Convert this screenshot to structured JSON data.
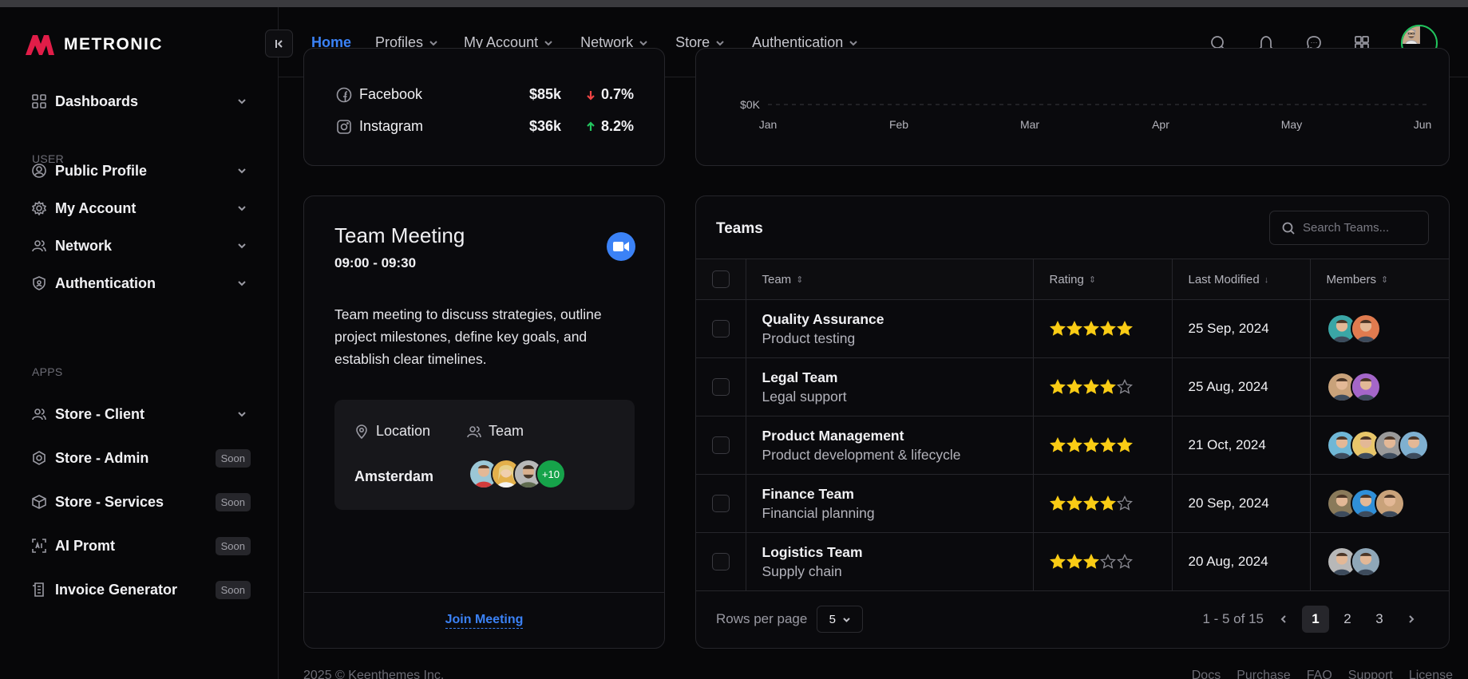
{
  "app": {
    "brand": "METRONIC"
  },
  "sidebar": {
    "dashboards": "Dashboards",
    "section_user": "USER",
    "public_profile": "Public Profile",
    "my_account": "My Account",
    "network": "Network",
    "authentication": "Authentication",
    "section_apps": "APPS",
    "store_client": "Store - Client",
    "store_admin": "Store - Admin",
    "store_services": "Store - Services",
    "ai_promt": "AI Promt",
    "invoice_generator": "Invoice Generator",
    "soon_badge": "Soon"
  },
  "header": {
    "menu": [
      "Home",
      "Profiles",
      "My Account",
      "Network",
      "Store",
      "Authentication"
    ]
  },
  "social": [
    {
      "name": "Facebook",
      "amount": "$85k",
      "change": "0.7%",
      "direction": "down"
    },
    {
      "name": "Instagram",
      "amount": "$36k",
      "change": "8.2%",
      "direction": "up"
    }
  ],
  "chart_data": {
    "type": "line",
    "categories": [
      "Jan",
      "Feb",
      "Mar",
      "Apr",
      "May",
      "Jun"
    ],
    "y_tick_visible": "$0K",
    "grid": true
  },
  "meeting": {
    "title": "Team Meeting",
    "time": "09:00 - 09:30",
    "description": "Team meeting to discuss strategies, outline project milestones, define key goals, and establish clear timelines.",
    "location_label": "Location",
    "team_label": "Team",
    "location_value": "Amsterdam",
    "more_members": "+10",
    "join_label": "Join Meeting"
  },
  "teams": {
    "title": "Teams",
    "search_placeholder": "Search Teams...",
    "columns": [
      "Team",
      "Rating",
      "Last Modified",
      "Members"
    ],
    "rows": [
      {
        "name": "Quality Assurance",
        "desc": "Product testing",
        "rating": 5,
        "modified": "25 Sep, 2024",
        "members": 2
      },
      {
        "name": "Legal Team",
        "desc": "Legal support",
        "rating": 4,
        "modified": "25 Aug, 2024",
        "members": 2
      },
      {
        "name": "Product Management",
        "desc": "Product development & lifecycle",
        "rating": 5,
        "modified": "21 Oct, 2024",
        "members": 4
      },
      {
        "name": "Finance Team",
        "desc": "Financial planning",
        "rating": 4,
        "modified": "20 Sep, 2024",
        "members": 3
      },
      {
        "name": "Logistics Team",
        "desc": "Supply chain",
        "rating": 3,
        "modified": "20 Aug, 2024",
        "members": 2
      }
    ],
    "rows_per_page_label": "Rows per page",
    "rows_per_page_value": "5",
    "page_info": "1 - 5 of 15",
    "pages": [
      "1",
      "2",
      "3"
    ]
  },
  "footer": {
    "copyright": "2025 ©  Keenthemes Inc.",
    "links": [
      "Docs",
      "Purchase",
      "FAQ",
      "Support",
      "License"
    ]
  },
  "colors": {
    "accent": "#3b82f6",
    "up": "#22c55e",
    "down": "#ef4444",
    "star": "#facc15"
  }
}
